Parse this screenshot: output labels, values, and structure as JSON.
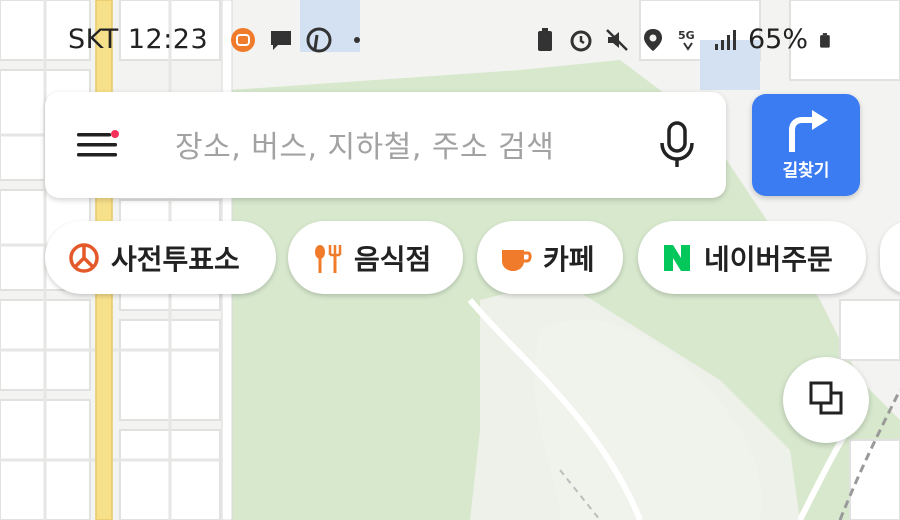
{
  "status_bar": {
    "carrier": "SKT",
    "time": "12:23",
    "battery": "65%",
    "network": "5G"
  },
  "search": {
    "placeholder": "장소, 버스, 지하철, 주소 검색"
  },
  "directions": {
    "label": "길찾기"
  },
  "chips": [
    {
      "label": "사전투표소",
      "icon": "ballot-icon"
    },
    {
      "label": "음식점",
      "icon": "restaurant-icon"
    },
    {
      "label": "카페",
      "icon": "cafe-icon"
    },
    {
      "label": "네이버주문",
      "icon": "naver-n-icon"
    }
  ],
  "colors": {
    "accent": "#3b7cf2",
    "chip_icon_orange": "#f07b2a",
    "naver_green": "#03c75a",
    "park_green": "#d9ead0",
    "road_yellow": "#f7e08a"
  }
}
